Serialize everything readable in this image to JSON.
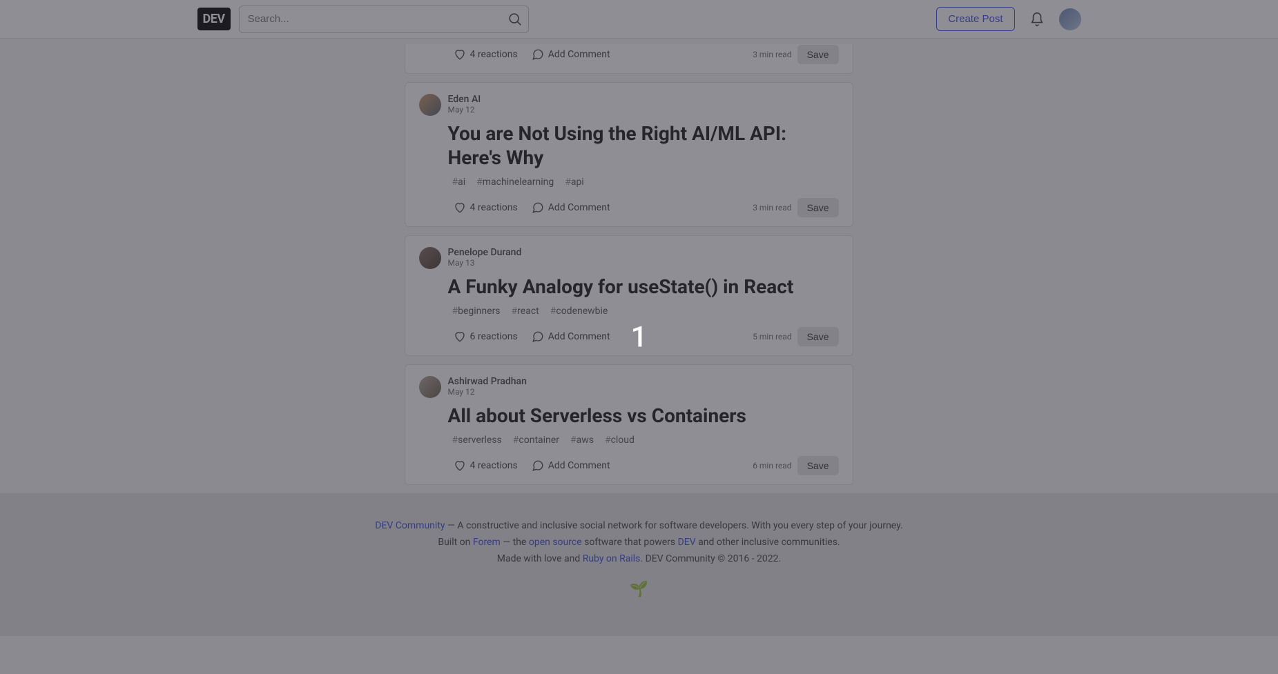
{
  "header": {
    "logo": "DEV",
    "search_placeholder": "Search...",
    "create_post": "Create Post"
  },
  "overlay": {
    "number": "1"
  },
  "posts": [
    {
      "author": "",
      "date": "",
      "title": "",
      "tags": [],
      "reactions": "4 reactions",
      "comment_label": "Add Comment",
      "read_time": "3 min read",
      "save": "Save",
      "partial": true
    },
    {
      "author": "Eden AI",
      "date": "May 12",
      "title": "You are Not Using the Right AI/ML API: Here's Why",
      "tags": [
        "ai",
        "machinelearning",
        "api"
      ],
      "reactions": "4 reactions",
      "comment_label": "Add Comment",
      "read_time": "3 min read",
      "save": "Save"
    },
    {
      "author": "Penelope Durand",
      "date": "May 13",
      "title": "A Funky Analogy for useState() in React",
      "tags": [
        "beginners",
        "react",
        "codenewbie"
      ],
      "reactions": "6 reactions",
      "comment_label": "Add Comment",
      "read_time": "5 min read",
      "save": "Save"
    },
    {
      "author": "Ashirwad Pradhan",
      "date": "May 12",
      "title": "All about Serverless vs Containers",
      "tags": [
        "serverless",
        "container",
        "aws",
        "cloud"
      ],
      "reactions": "4 reactions",
      "comment_label": "Add Comment",
      "read_time": "6 min read",
      "save": "Save"
    }
  ],
  "footer": {
    "line1_link": "DEV Community",
    "line1_rest": " — A constructive and inclusive social network for software developers. With you every step of your journey.",
    "line2_pre": "Built on ",
    "line2_forem": "Forem",
    "line2_mid1": " — the ",
    "line2_opensource": "open source",
    "line2_mid2": " software that powers ",
    "line2_dev": "DEV",
    "line2_end": " and other inclusive communities.",
    "line3_pre": "Made with love and ",
    "line3_ruby": "Ruby on Rails",
    "line3_end": ". DEV Community © 2016 - 2022."
  }
}
